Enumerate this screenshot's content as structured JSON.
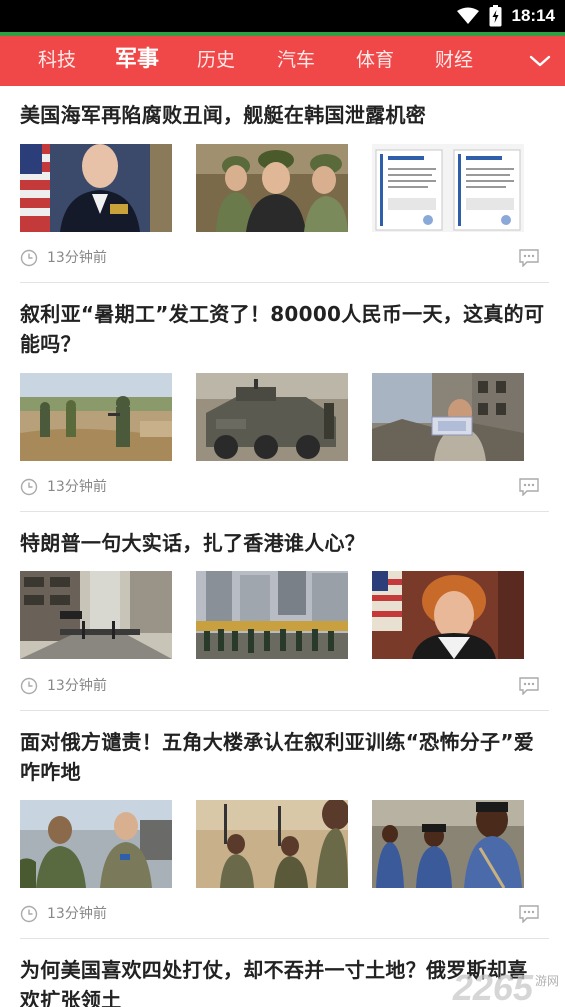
{
  "status": {
    "time": "18:14"
  },
  "nav": {
    "items": [
      {
        "label": "科技"
      },
      {
        "label": "军事"
      },
      {
        "label": "历史"
      },
      {
        "label": "汽车"
      },
      {
        "label": "体育"
      },
      {
        "label": "财经"
      }
    ],
    "active_index": 1
  },
  "articles": [
    {
      "title": "美国海军再陷腐败丑闻，舰艇在韩国泄露机密",
      "time": "13分钟前"
    },
    {
      "title": "叙利亚“暑期工”发工资了！80000人民币一天，这真的可能吗？",
      "time": "13分钟前"
    },
    {
      "title": "特朗普一句大实话，扎了香港谁人心？",
      "time": "13分钟前"
    },
    {
      "title": "面对俄方谴责！五角大楼承认在叙利亚训练“恐怖分子”爱咋咋地",
      "time": "13分钟前"
    },
    {
      "title": "为何美国喜欢四处打仗，却不吞并一寸土地？俄罗斯却喜欢扩张领土",
      "time": ""
    }
  ],
  "watermark": {
    "number": "2265",
    "text": "游网"
  },
  "colors": {
    "nav_bg": "#f04848",
    "status_accent": "#2ea043"
  }
}
